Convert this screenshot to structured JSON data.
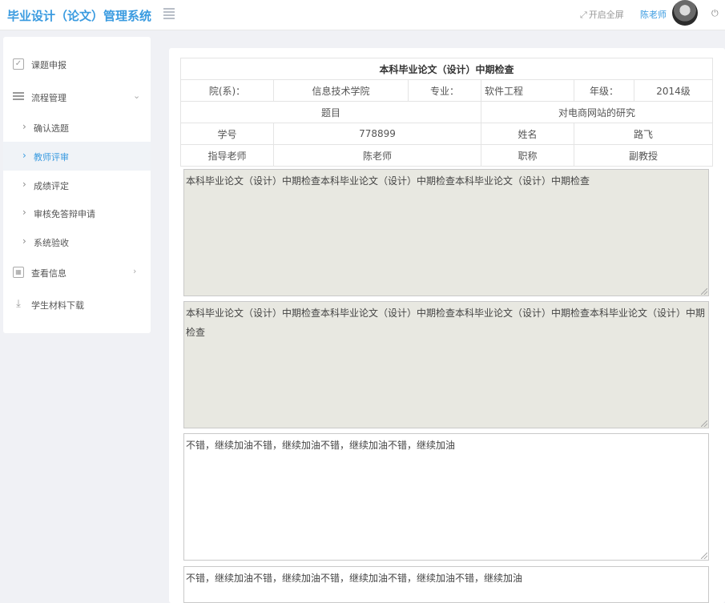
{
  "header": {
    "app_title": "毕业设计（论文）管理系统",
    "fullscreen_label": "开启全屏",
    "username": "陈老师"
  },
  "sidebar": {
    "items": [
      {
        "label": "课题申报",
        "icon": "checkbox-icon"
      },
      {
        "label": "流程管理",
        "icon": "list-icon",
        "expanded": true
      },
      {
        "label": "确认选题"
      },
      {
        "label": "教师评审",
        "active": true
      },
      {
        "label": "成绩评定"
      },
      {
        "label": "审核免答辩申请"
      },
      {
        "label": "系统验收"
      },
      {
        "label": "查看信息",
        "icon": "calendar-icon"
      },
      {
        "label": "学生材料下载",
        "icon": "download-icon"
      }
    ]
  },
  "form": {
    "title": "本科毕业论文（设计）中期检查",
    "dept_label": "院(系)：",
    "dept_value": "信息技术学院",
    "major_label": "专业：",
    "major_value": "软件工程",
    "grade_label": "年级：",
    "grade_value": "2014级",
    "topic_label": "题目",
    "topic_value": "对电商网站的研究",
    "student_id_label": "学号",
    "student_id_value": "778899",
    "name_label": "姓名",
    "name_value": "路飞",
    "advisor_label": "指导老师",
    "advisor_value": "陈老师",
    "rank_label": "职称",
    "rank_value": "副教授",
    "textareas": [
      "本科毕业论文（设计）中期检查本科毕业论文（设计）中期检查本科毕业论文（设计）中期检查",
      "本科毕业论文（设计）中期检查本科毕业论文（设计）中期检查本科毕业论文（设计）中期检查本科毕业论文（设计）中期检查",
      "不错，继续加油不错，继续加油不错，继续加油不错，继续加油",
      "不错，继续加油不错，继续加油不错，继续加油不错，继续加油不错，继续加油"
    ]
  }
}
